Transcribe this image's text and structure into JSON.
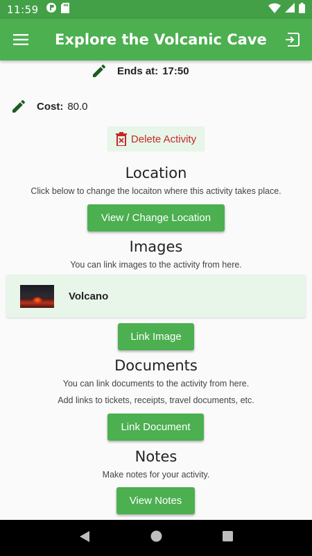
{
  "status_bar": {
    "time": "11:59"
  },
  "app_bar": {
    "title": "Explore the Volcanic Cave"
  },
  "activity": {
    "ends_label": "Ends at:",
    "ends_value": "17:50",
    "cost_label": "Cost:",
    "cost_value": "80.0",
    "delete_label": "Delete Activity"
  },
  "location": {
    "title": "Location",
    "description": "Click below to change the locaiton where this activity takes place.",
    "button_label": "View / Change Location"
  },
  "images": {
    "title": "Images",
    "description": "You can link images to the activity from here.",
    "items": [
      {
        "name": "Volcano"
      }
    ],
    "button_label": "Link Image"
  },
  "documents": {
    "title": "Documents",
    "description_1": "You can link documents to the activity from here.",
    "description_2": "Add links to tickets, receipts, travel documents, etc.",
    "button_label": "Link Document"
  },
  "notes": {
    "title": "Notes",
    "description": "Make notes for your activity.",
    "button_label": "View Notes"
  },
  "colors": {
    "primary": "#4caf50",
    "primary_dark": "#43a047",
    "card_background": "#e8f5e9",
    "danger": "#c62828",
    "icon_dark_green": "#1b5e20"
  }
}
